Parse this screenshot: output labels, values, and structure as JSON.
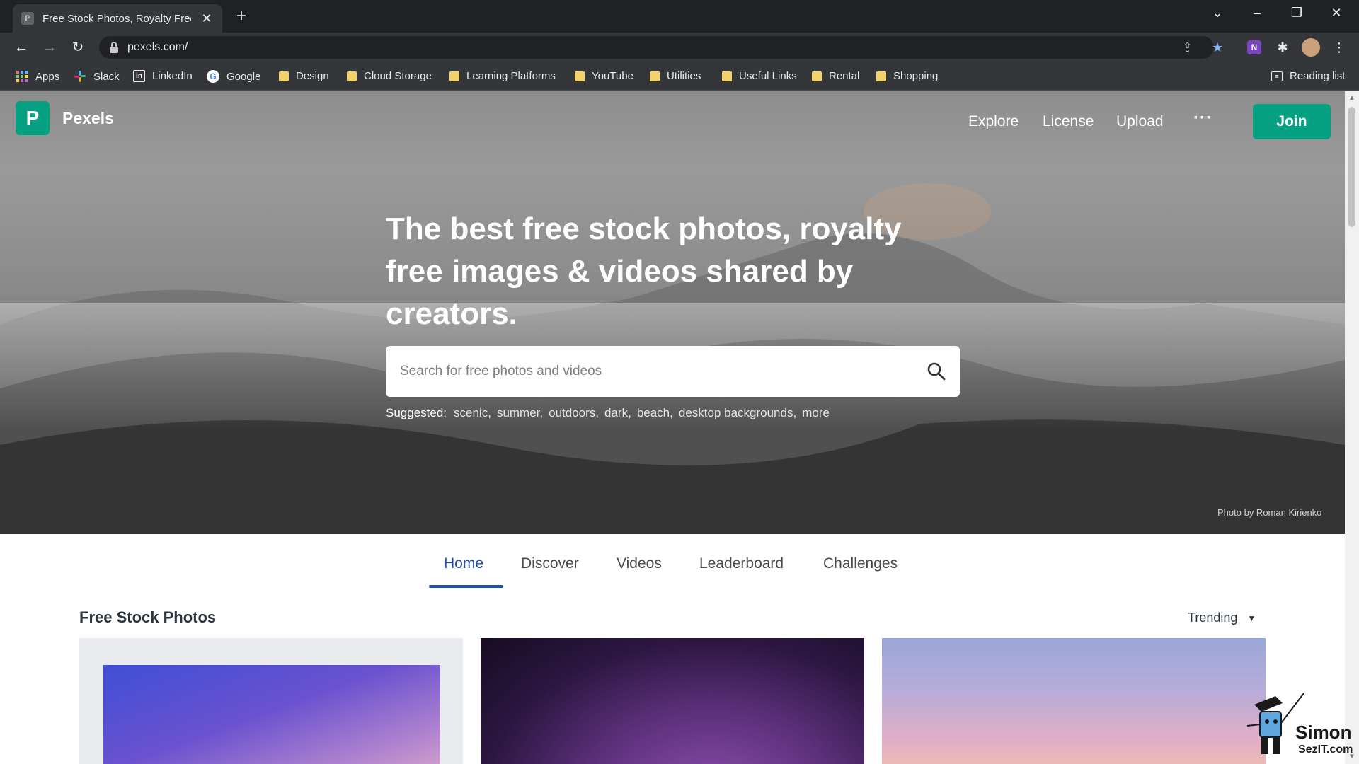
{
  "browser": {
    "tab_title": "Free Stock Photos, Royalty Free",
    "tab_favicon": "pexels-favicon",
    "url": "pexels.com/",
    "bookmarks": [
      {
        "label": "Apps",
        "icon": "apps-grid-icon"
      },
      {
        "label": "Slack",
        "icon": "slack-icon"
      },
      {
        "label": "LinkedIn",
        "icon": "linkedin-icon"
      },
      {
        "label": "Google",
        "icon": "google-icon"
      },
      {
        "label": "Design",
        "icon": "folder-icon"
      },
      {
        "label": "Cloud Storage",
        "icon": "folder-icon"
      },
      {
        "label": "Learning Platforms",
        "icon": "folder-icon"
      },
      {
        "label": "YouTube",
        "icon": "folder-icon"
      },
      {
        "label": "Utilities",
        "icon": "folder-icon"
      },
      {
        "label": "Useful Links",
        "icon": "folder-icon"
      },
      {
        "label": "Rental",
        "icon": "folder-icon"
      },
      {
        "label": "Shopping",
        "icon": "folder-icon"
      }
    ],
    "reading_list": "Reading list"
  },
  "site": {
    "logo_letter": "P",
    "name": "Pexels",
    "nav": [
      "Explore",
      "License",
      "Upload"
    ],
    "more": "···",
    "join": "Join",
    "accent": "#05a081"
  },
  "hero": {
    "headline": "The best free stock photos, royalty free images & videos shared by creators.",
    "search_placeholder": "Search for free photos and videos",
    "suggested_label": "Suggested:",
    "suggested": [
      "scenic,",
      "summer,",
      "outdoors,",
      "dark,",
      "beach,",
      "desktop backgrounds,",
      "more"
    ],
    "credit": "Photo by Roman Kirienko"
  },
  "tabs": [
    "Home",
    "Discover",
    "Videos",
    "Leaderboard",
    "Challenges"
  ],
  "active_tab": "Home",
  "section": {
    "title": "Free Stock Photos",
    "sort": "Trending"
  },
  "watermark": {
    "line1": "Simon",
    "line2": "SezIT.com"
  }
}
